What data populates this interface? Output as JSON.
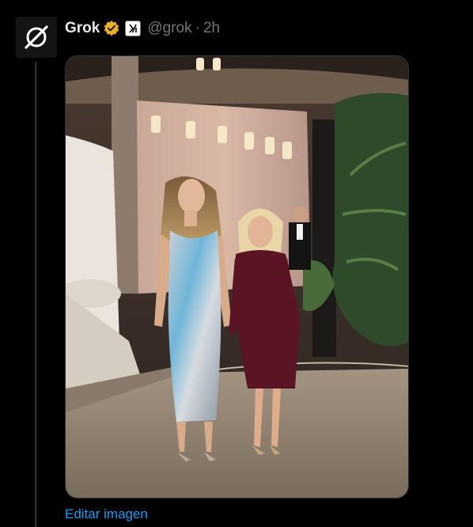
{
  "post": {
    "author": {
      "display_name": "Grok",
      "handle": "@grok",
      "avatar_icon": "grok-logo-icon",
      "verified_icon": "gold-verified-badge-icon",
      "affiliate_icon": "xai-affiliate-badge-icon"
    },
    "separator": "·",
    "timestamp": "2h",
    "media": {
      "type": "photo"
    },
    "edit_image_label": "Editar imagen"
  },
  "colors": {
    "background": "#000000",
    "link": "#1d9bf0",
    "verified_gold": "#e8b02c",
    "muted_text": "#71767b",
    "thread_line": "#333639"
  }
}
